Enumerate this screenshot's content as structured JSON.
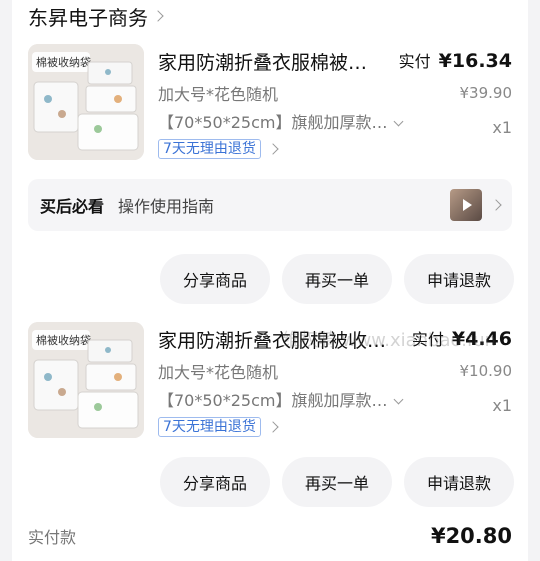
{
  "shop": {
    "name": "东昇电子商务"
  },
  "items": [
    {
      "thumb_text": "棉被收纳袋",
      "title": "家用防潮折叠衣服棉被…",
      "spec": "加大号*花色随机",
      "spec2": "【70*50*25cm】旗舰加厚款…",
      "return_tag": "7天无理由退货",
      "paid_label": "实付",
      "paid_amount": "¥16.34",
      "original_price": "¥39.90",
      "quantity": "x1"
    },
    {
      "thumb_text": "棉被收纳袋",
      "title": "家用防潮折叠衣服棉被收…",
      "spec": "加大号*花色随机",
      "spec2": "【70*50*25cm】旗舰加厚款…",
      "return_tag": "7天无理由退货",
      "paid_label": "实付",
      "paid_amount": "¥4.46",
      "original_price": "¥10.90",
      "quantity": "x1"
    }
  ],
  "after_sale": {
    "title": "买后必看",
    "text": "操作使用指南"
  },
  "actions": {
    "share": "分享商品",
    "rebuy": "再买一单",
    "refund": "申请退款"
  },
  "watermark": "维权骑 www.xianbao.fun",
  "total": {
    "label": "实付款",
    "value": "¥20.80"
  }
}
